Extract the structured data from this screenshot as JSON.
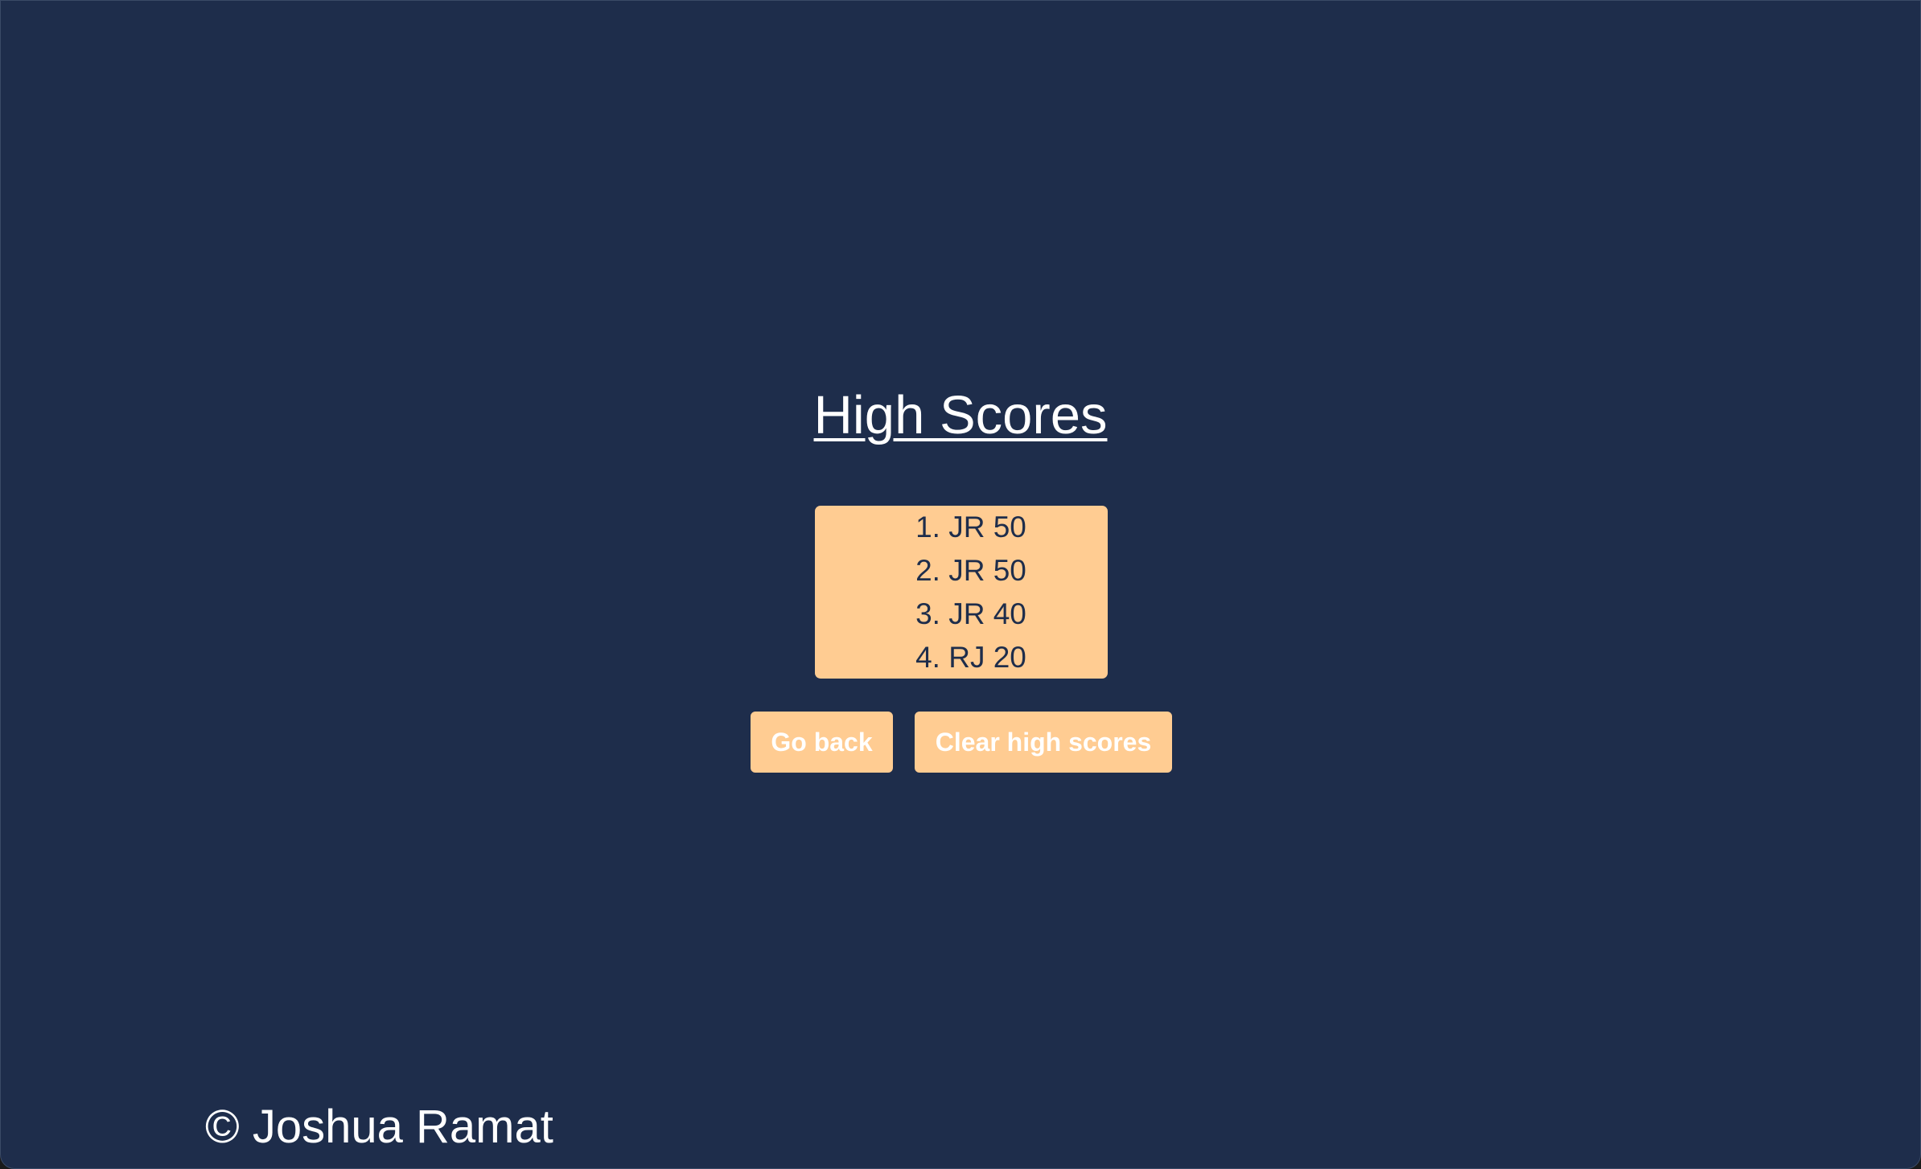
{
  "page": {
    "title": "High Scores"
  },
  "scores": [
    "1. JR 50",
    "2. JR 50",
    "3. JR 40",
    "4. RJ 20"
  ],
  "buttons": {
    "go_back": "Go back",
    "clear": "Clear high scores"
  },
  "footer": {
    "copyright": "© Joshua Ramat"
  },
  "colors": {
    "background": "#1e2d4b",
    "accent": "#ffcc92",
    "text_light": "#ffffff",
    "text_dark": "#1e2d4b"
  }
}
